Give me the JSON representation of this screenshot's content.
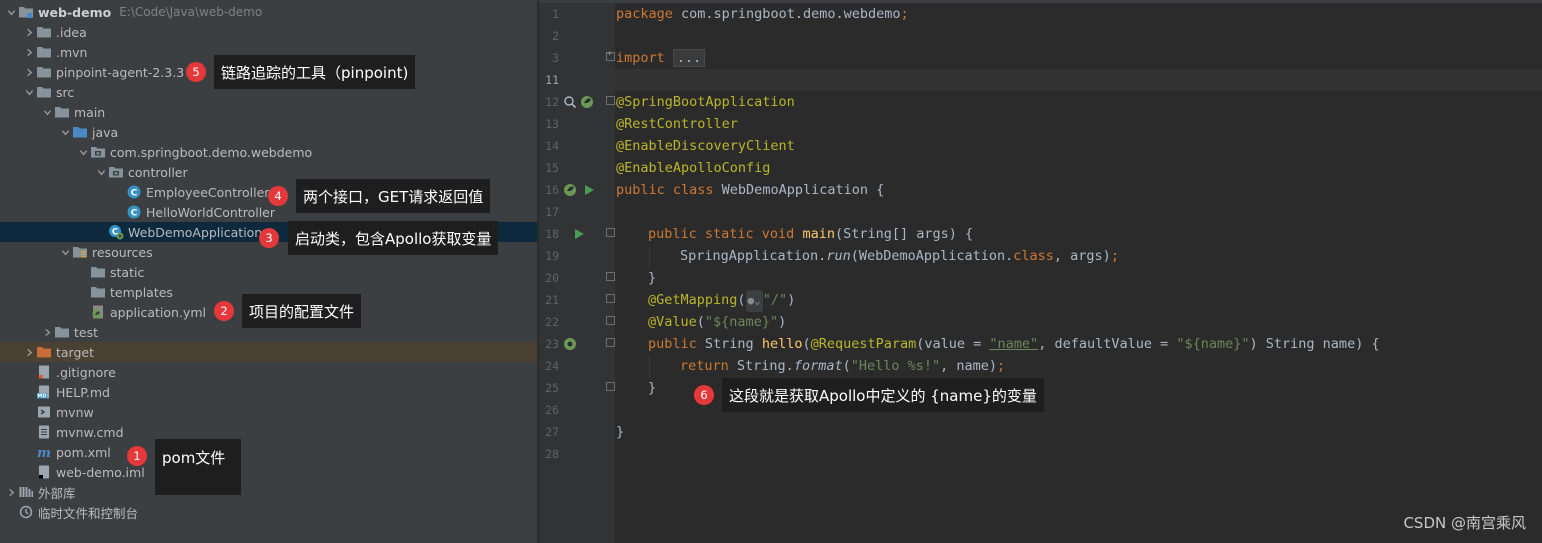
{
  "project": {
    "rows": [
      {
        "label": "web-demo",
        "hint": "E:\\Code\\Java\\web-demo",
        "icon": "module-folder-icon",
        "arrow": "down",
        "indent": 0,
        "bold": true
      },
      {
        "label": ".idea",
        "icon": "folder-icon",
        "arrow": "right",
        "indent": 1
      },
      {
        "label": ".mvn",
        "icon": "folder-icon",
        "arrow": "right",
        "indent": 1
      },
      {
        "label": "pinpoint-agent-2.3.3",
        "icon": "folder-icon",
        "arrow": "right",
        "indent": 1
      },
      {
        "label": "src",
        "icon": "folder-icon",
        "arrow": "down",
        "indent": 1
      },
      {
        "label": "main",
        "icon": "folder-icon",
        "arrow": "down",
        "indent": 2
      },
      {
        "label": "java",
        "icon": "source-folder-icon",
        "arrow": "down",
        "indent": 3
      },
      {
        "label": "com.springboot.demo.webdemo",
        "icon": "package-icon",
        "arrow": "down",
        "indent": 4
      },
      {
        "label": "controller",
        "icon": "package-icon",
        "arrow": "down",
        "indent": 5
      },
      {
        "label": "EmployeeController",
        "icon": "java-class-icon",
        "arrow": "none",
        "indent": 6
      },
      {
        "label": "HelloWorldController",
        "icon": "java-class-icon",
        "arrow": "none",
        "indent": 6
      },
      {
        "label": "WebDemoApplication",
        "icon": "spring-boot-class-icon",
        "arrow": "none",
        "indent": 5,
        "selected": true
      },
      {
        "label": "resources",
        "icon": "resources-folder-icon",
        "arrow": "down",
        "indent": 3
      },
      {
        "label": "static",
        "icon": "folder-icon",
        "arrow": "none",
        "indent": 4
      },
      {
        "label": "templates",
        "icon": "folder-icon",
        "arrow": "none",
        "indent": 4
      },
      {
        "label": "application.yml",
        "icon": "spring-config-icon",
        "arrow": "none",
        "indent": 4
      },
      {
        "label": "test",
        "icon": "folder-icon",
        "arrow": "right",
        "indent": 2
      },
      {
        "label": "target",
        "icon": "excluded-folder-icon",
        "arrow": "right",
        "indent": 1,
        "excluded": true
      },
      {
        "label": ".gitignore",
        "icon": "gitignore-file-icon",
        "arrow": "none",
        "indent": 1
      },
      {
        "label": "HELP.md",
        "icon": "markdown-file-icon",
        "arrow": "none",
        "indent": 1
      },
      {
        "label": "mvnw",
        "icon": "script-file-icon",
        "arrow": "none",
        "indent": 1
      },
      {
        "label": "mvnw.cmd",
        "icon": "text-file-icon",
        "arrow": "none",
        "indent": 1
      },
      {
        "label": "pom.xml",
        "icon": "maven-icon",
        "arrow": "none",
        "indent": 1
      },
      {
        "label": "web-demo.iml",
        "icon": "iml-file-icon",
        "arrow": "none",
        "indent": 1
      },
      {
        "label": "外部库",
        "icon": "libraries-icon",
        "arrow": "right",
        "indent": 0
      },
      {
        "label": "临时文件和控制台",
        "icon": "scratches-icon",
        "arrow": "none",
        "indent": 0
      }
    ]
  },
  "editor": {
    "current_line": "11",
    "lines": [
      {
        "no": "1"
      },
      {
        "no": "2"
      },
      {
        "no": "3"
      },
      {
        "no": "11"
      },
      {
        "no": "12"
      },
      {
        "no": "13"
      },
      {
        "no": "14"
      },
      {
        "no": "15"
      },
      {
        "no": "16"
      },
      {
        "no": "17"
      },
      {
        "no": "18"
      },
      {
        "no": "19"
      },
      {
        "no": "20"
      },
      {
        "no": "21"
      },
      {
        "no": "22"
      },
      {
        "no": "23"
      },
      {
        "no": "24"
      },
      {
        "no": "25"
      },
      {
        "no": "26"
      },
      {
        "no": "27"
      },
      {
        "no": "28"
      }
    ],
    "code": {
      "l1_kw": "package",
      "l1_pkg": " com.springboot.demo.webdemo",
      "l1_semi": ";",
      "l3_kw": "import",
      "l3_folded": "...",
      "l12": "@SpringBootApplication",
      "l13": "@RestController",
      "l14": "@EnableDiscoveryClient",
      "l15": "@EnableApolloConfig",
      "l16_kw": "public class",
      "l16_name": " WebDemoApplication {",
      "l18_kw": "public static void",
      "l18_fn": "main",
      "l18_rest": "(String[] args) {",
      "l19_a": "SpringApplication.",
      "l19_b": "run",
      "l19_c": "(WebDemoApplication.",
      "l19_d": "class",
      "l19_e": ", args)",
      "l19_f": ";",
      "l20": "}",
      "l21_ann": "@GetMapping",
      "l21_open": "(",
      "l21_str": "\"/\"",
      "l21_close": ")",
      "l22_ann": "@Value",
      "l22_open": "(",
      "l22_str": "\"${name}\"",
      "l22_close": ")",
      "l23_kw": "public",
      "l23_a": " String ",
      "l23_fn": "hello",
      "l23_b": "(",
      "l23_ann": "@RequestParam",
      "l23_c": "(value = ",
      "l23_s1": "\"name\"",
      "l23_d": ", defaultValue = ",
      "l23_s2": "\"${name}\"",
      "l23_e": ") String name) {",
      "l24_kw": "return",
      "l24_a": " String.",
      "l24_b": "format",
      "l24_c": "(",
      "l24_s": "\"Hello %s!\"",
      "l24_d": ", name)",
      "l24_semi": ";",
      "l25": "}",
      "l27": "}"
    }
  },
  "annotations": [
    {
      "num": "1",
      "text": "pom文件"
    },
    {
      "num": "2",
      "text": "项目的配置文件"
    },
    {
      "num": "3",
      "text": "启动类，包含Apollo获取变量"
    },
    {
      "num": "4",
      "text": "两个接口，GET请求返回值"
    },
    {
      "num": "5",
      "text": "链路追踪的工具（pinpoint)"
    },
    {
      "num": "6",
      "text": "这段就是获取Apollo中定义的 {name}的变量"
    }
  ],
  "watermark": "CSDN @南宫乘风",
  "colors": {
    "panel_bg": "#3c3f41",
    "editor_bg": "#2b2b2b",
    "selection": "#0d293e",
    "keyword": "#cc7832",
    "annotation": "#bbb529",
    "string": "#6a8759",
    "function": "#ffc66d",
    "badge": "#e5383b"
  }
}
